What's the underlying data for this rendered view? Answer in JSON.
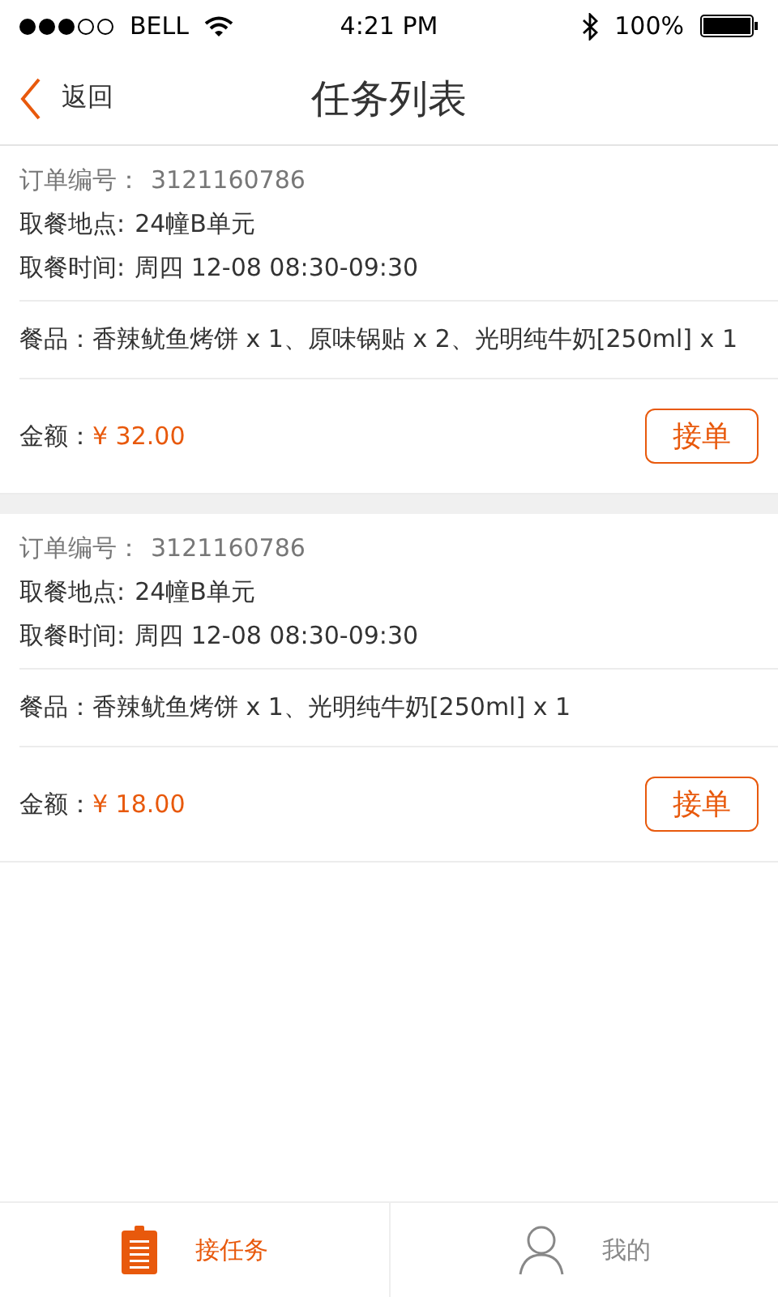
{
  "status_bar": {
    "carrier": "BELL",
    "time": "4:21 PM",
    "battery": "100%"
  },
  "nav": {
    "back": "返回",
    "title": "任务列表"
  },
  "orders": [
    {
      "number_label": "订单编号：",
      "number": "3121160786",
      "place_label": "取餐地点:",
      "place": "24幢B单元",
      "time_label": "取餐时间:",
      "time": "周四 12-08  08:30-09:30",
      "items_label": "餐品：",
      "items": "香辣鱿鱼烤饼 x 1、原味锅贴 x 2、光明纯牛奶[250ml] x 1",
      "amount_label": "金额：",
      "amount": "¥ 32.00",
      "action": "接单"
    },
    {
      "number_label": "订单编号：",
      "number": "3121160786",
      "place_label": "取餐地点:",
      "place": "24幢B单元",
      "time_label": "取餐时间:",
      "time": "周四 12-08  08:30-09:30",
      "items_label": "餐品：",
      "items": "香辣鱿鱼烤饼 x 1、光明纯牛奶[250ml] x 1",
      "amount_label": "金额：",
      "amount": "¥ 18.00",
      "action": "接单"
    }
  ],
  "tabs": [
    {
      "kind": "tasks",
      "label": "接任务",
      "selected": true
    },
    {
      "kind": "profile",
      "label": "我的",
      "selected": false
    }
  ]
}
